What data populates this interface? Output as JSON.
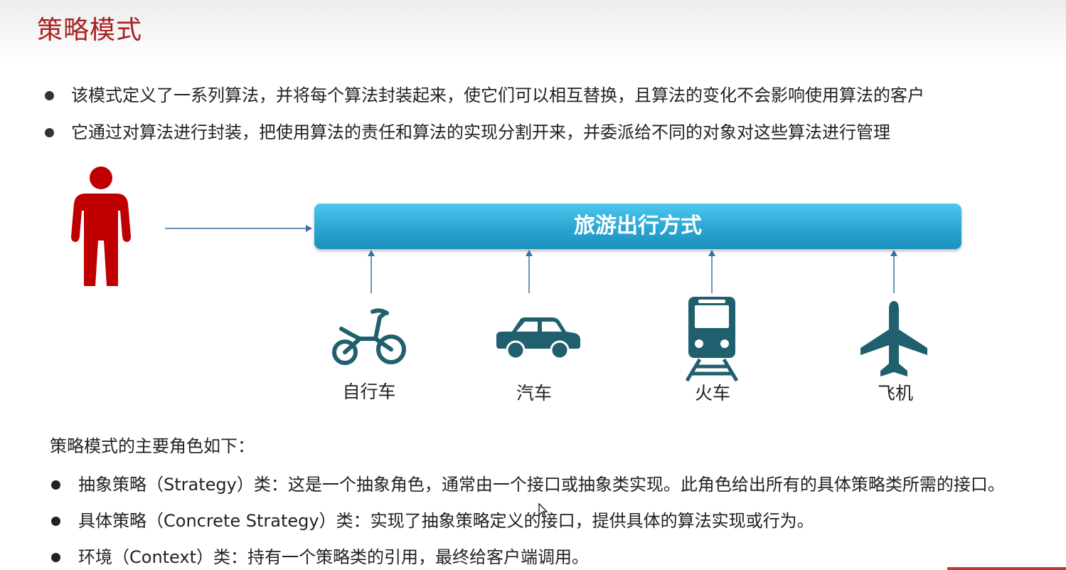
{
  "page": {
    "title": "策略模式",
    "bullets": [
      "该模式定义了一系列算法，并将每个算法封装起来，使它们可以相互替换，且算法的变化不会影响使用算法的客户",
      "它通过对算法进行封装，把使用算法的责任和算法的实现分割开来，并委派给不同的对象对这些算法进行管理"
    ]
  },
  "diagram": {
    "context_label": "旅游出行方式",
    "strategies": [
      {
        "label": "自行车",
        "icon": "bicycle-icon"
      },
      {
        "label": "汽车",
        "icon": "car-icon"
      },
      {
        "label": "火车",
        "icon": "train-icon"
      },
      {
        "label": "飞机",
        "icon": "airplane-icon"
      }
    ],
    "colors": {
      "person": "#c00000",
      "bar": "#2aa6d3",
      "vehicle": "#1f5f6e",
      "arrow": "#3a6ea5",
      "title": "#a82020"
    }
  },
  "roles": {
    "title": "策略模式的主要角色如下：",
    "items": [
      "抽象策略（Strategy）类：这是一个抽象角色，通常由一个接口或抽象类实现。此角色给出所有的具体策略类所需的接口。",
      "具体策略（Concrete Strategy）类：实现了抽象策略定义的接口，提供具体的算法实现或行为。",
      "环境（Context）类：持有一个策略类的引用，最终给客户端调用。"
    ]
  }
}
